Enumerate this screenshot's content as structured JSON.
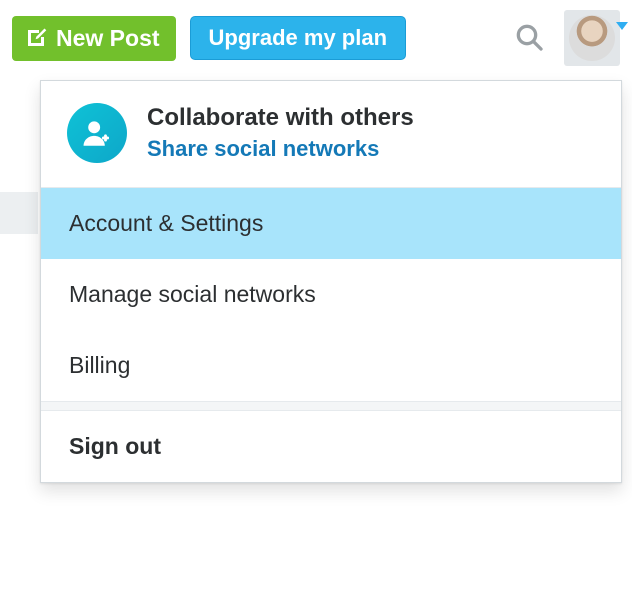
{
  "toolbar": {
    "new_post_label": "New Post",
    "upgrade_label": "Upgrade my plan"
  },
  "menu": {
    "header_title": "Collaborate with others",
    "header_action": "Share social networks",
    "items": [
      {
        "label": "Account & Settings",
        "highlighted": true
      },
      {
        "label": "Manage social networks"
      },
      {
        "label": "Billing"
      }
    ],
    "sign_out_label": "Sign out"
  },
  "icons": {
    "compose": "compose-icon",
    "search": "search-icon",
    "add_user": "add-user-icon",
    "avatar": "avatar"
  },
  "colors": {
    "green": "#72c02c",
    "blue": "#2cb3eb",
    "hover": "#a8e4fb",
    "link": "#1479b7",
    "teal": "#0fc2d6"
  }
}
